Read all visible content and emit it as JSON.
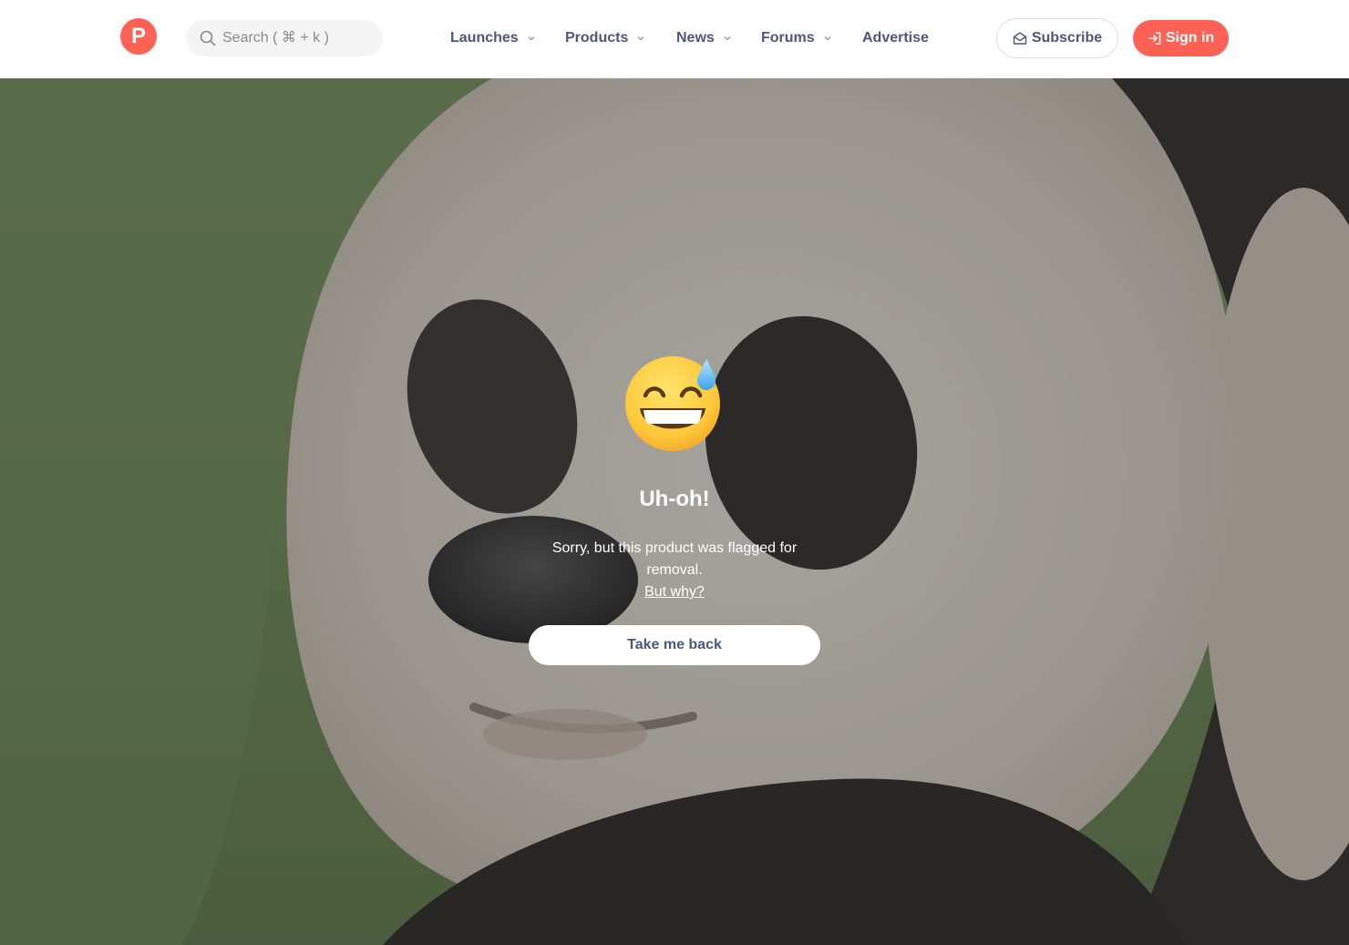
{
  "header": {
    "logo_letter": "P",
    "search_placeholder": "Search ( ⌘ + k )",
    "nav": [
      {
        "label": "Launches",
        "has_dropdown": true
      },
      {
        "label": "Products",
        "has_dropdown": true
      },
      {
        "label": "News",
        "has_dropdown": true
      },
      {
        "label": "Forums",
        "has_dropdown": true
      },
      {
        "label": "Advertise",
        "has_dropdown": false
      }
    ],
    "subscribe_label": "Subscribe",
    "signin_label": "Sign in"
  },
  "error": {
    "emoji": "grinning-face-with-sweat-icon",
    "title": "Uh-oh!",
    "message": "Sorry, but this product was flagged for removal.",
    "link_label": "But why?",
    "button_label": "Take me back"
  },
  "colors": {
    "brand": "#ff6154",
    "nav_text": "#4b587c"
  }
}
